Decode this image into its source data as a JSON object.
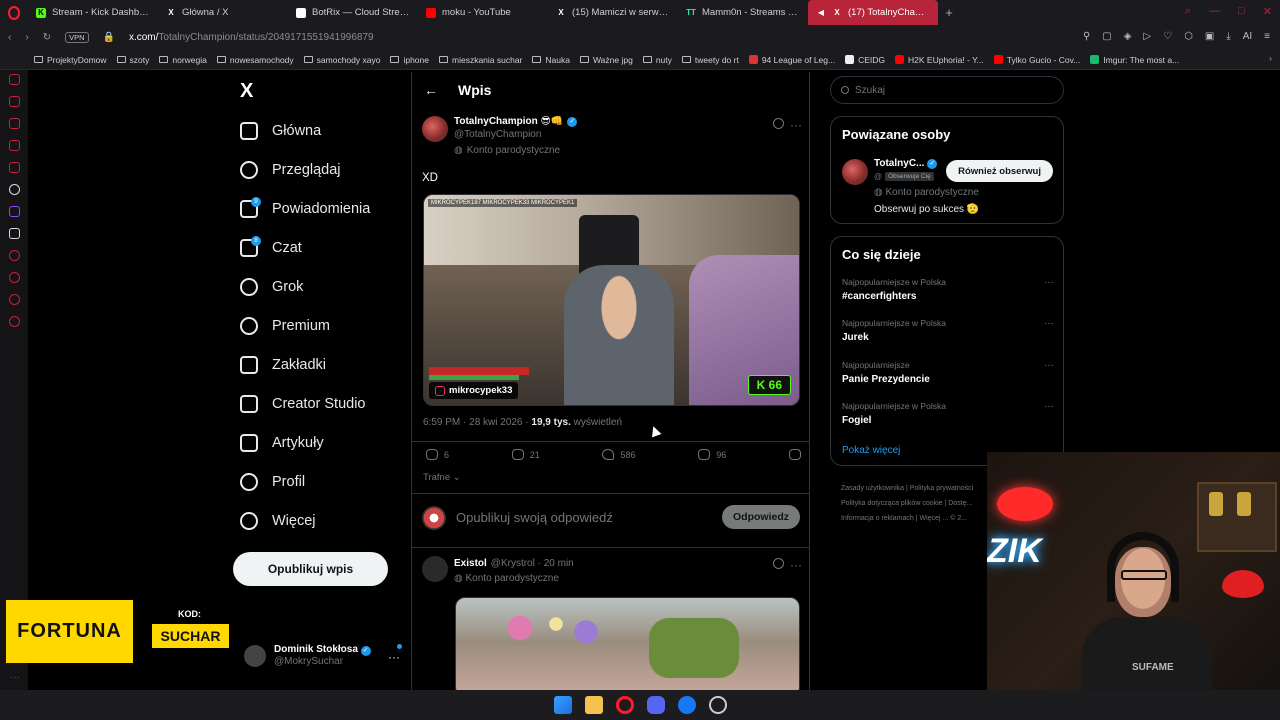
{
  "browser": {
    "tabs": [
      {
        "label": "Stream - Kick Dashboard",
        "icon": "kick-icon",
        "color": "#53fc18"
      },
      {
        "label": "Główna / X",
        "icon": "x-icon",
        "color": "#ffffff"
      },
      {
        "label": "BotRix — Cloud Streaming",
        "icon": "botrix-icon",
        "color": "#ffffff"
      },
      {
        "label": "moku - YouTube",
        "icon": "youtube-icon",
        "color": "#ff0000"
      },
      {
        "label": "(15) Mamiczi w serwisie X",
        "icon": "x-icon",
        "color": "#ffffff"
      },
      {
        "label": "Mamm0n - Streams List a",
        "icon": "tt-icon",
        "color": "#2ea"
      },
      {
        "label": "(17) TotalnyChampion",
        "icon": "x-icon",
        "color": "#ffffff",
        "active": true
      }
    ],
    "new_tab": "+",
    "vpn": "VPN",
    "url_host": "x.com/",
    "url_path": "TotalnyChampion/status/2049171551941996879",
    "ai_label": "AI",
    "bookmarks": [
      {
        "label": "ProjektyDomow",
        "icon": "folder-icon"
      },
      {
        "label": "szoty",
        "icon": "folder-icon"
      },
      {
        "label": "norwegia",
        "icon": "folder-icon"
      },
      {
        "label": "nowesamochody",
        "icon": "folder-icon"
      },
      {
        "label": "samochody xayo",
        "icon": "folder-icon"
      },
      {
        "label": "iphone",
        "icon": "folder-icon"
      },
      {
        "label": "mieszkania suchar",
        "icon": "folder-icon"
      },
      {
        "label": "Nauka",
        "icon": "folder-icon"
      },
      {
        "label": "Ważne jpg",
        "icon": "folder-icon"
      },
      {
        "label": "nuty",
        "icon": "folder-icon"
      },
      {
        "label": "tweety do rt",
        "icon": "folder-icon"
      },
      {
        "label": "94 League of Leg...",
        "icon": "lol-icon",
        "color": "#d33"
      },
      {
        "label": "CEIDG",
        "icon": "ceidg-icon",
        "color": "#eee"
      },
      {
        "label": "H2K EUphoria! - Y...",
        "icon": "youtube-icon",
        "color": "#ff0000"
      },
      {
        "label": "Tylko Gucio - Cov...",
        "icon": "youtube-icon",
        "color": "#ff0000"
      },
      {
        "label": "Imgur: The most a...",
        "icon": "imgur-icon",
        "color": "#1bb76e"
      }
    ]
  },
  "nav": {
    "logo": "X",
    "items": [
      {
        "label": "Główna",
        "icon": "home-icon"
      },
      {
        "label": "Przeglądaj",
        "icon": "search-icon"
      },
      {
        "label": "Powiadomienia",
        "icon": "bell-icon",
        "badge": "9"
      },
      {
        "label": "Czat",
        "icon": "chat-icon",
        "badge": "8"
      },
      {
        "label": "Grok",
        "icon": "grok-icon"
      },
      {
        "label": "Premium",
        "icon": "premium-icon"
      },
      {
        "label": "Zakładki",
        "icon": "bookmark-icon"
      },
      {
        "label": "Creator Studio",
        "icon": "rocket-icon"
      },
      {
        "label": "Artykuły",
        "icon": "article-icon"
      },
      {
        "label": "Profil",
        "icon": "profile-icon"
      },
      {
        "label": "Więcej",
        "icon": "more-icon"
      }
    ],
    "post_button": "Opublikuj wpis",
    "account_name": "Dominik Stokłosa",
    "account_handle": "@MokrySuchar"
  },
  "timeline": {
    "back": "←",
    "title": "Wpis",
    "post": {
      "name": "TotalnyChampion 😎👊",
      "handle": "@TotalnyChampion",
      "label": "Konto parodystyczne",
      "text": "XD",
      "media": {
        "overlay_top": "MIKROCYPEK187  MIKROCYPEK33  MIKROCYPEK1",
        "ig_tag": "mikrocypek33",
        "kick_count": "K 66"
      },
      "time": "6:59 PM · 28 kwi 2026 · ",
      "views_count": "19,9 tys.",
      "views_label": " wyświetleń",
      "replies": "6",
      "reposts": "21",
      "likes": "586",
      "bookmarks": "96",
      "sort": "Trafne"
    },
    "reply_placeholder": "Opublikuj swoją odpowiedź",
    "reply_button": "Odpowiedz",
    "post2": {
      "name": "Existol",
      "handle": "@Krystrol · 20 min",
      "label": "Konto parodystyczne"
    }
  },
  "right": {
    "search_placeholder": "Szukaj",
    "related_title": "Powiązane osoby",
    "related_name": "TotalnyC...",
    "related_handle": "@",
    "related_follows": "Obserwuje Cię",
    "related_label": "Konto parodystyczne",
    "related_bio": "Obserwuj po sukces 🫡",
    "follow_button": "Również obserwuj",
    "trends_title": "Co się dzieje",
    "trends": [
      {
        "sub": "Najpopularniejsze w Polska",
        "name": "#cancerfighters"
      },
      {
        "sub": "Najpopularniejsze w Polska",
        "name": "Jurek"
      },
      {
        "sub": "Najpopularniejsze",
        "name": "Panie Prezydencie"
      },
      {
        "sub": "Najpopularniejsze w Polska",
        "name": "Fogiel"
      }
    ],
    "show_more": "Pokaż więcej",
    "footer": [
      "Zasady użytkownika",
      "Polityka prywatności",
      "Polityka dotycząca plików cookie",
      "Dostę...",
      "Informacja o reklamach",
      "Więcej ...",
      "© 2..."
    ]
  },
  "overlay": {
    "fortuna": "FORTUNA",
    "kod_label": "KOD:",
    "kod_value": "SUCHAR",
    "webcam_neon": "ZIK",
    "shirt": "SUFAME"
  }
}
